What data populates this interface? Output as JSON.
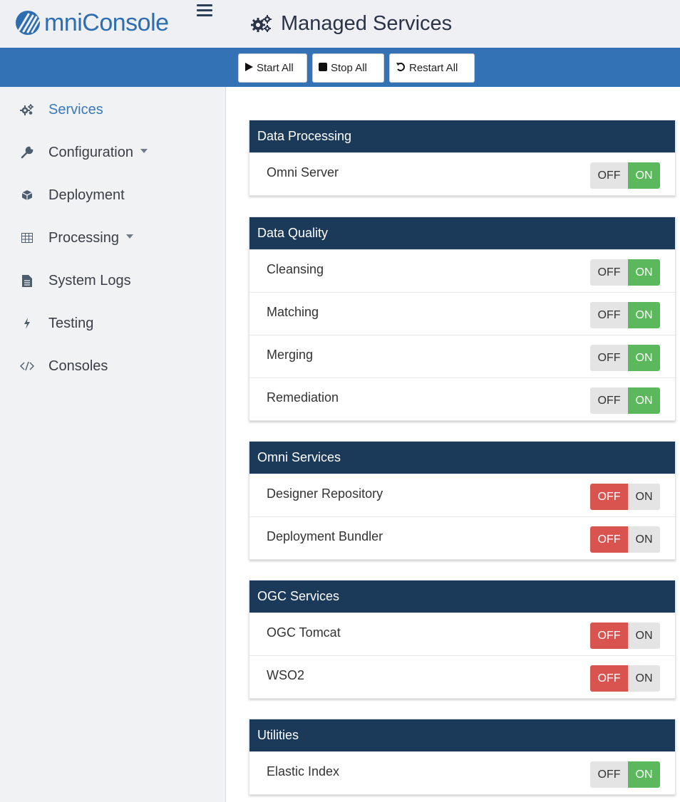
{
  "app": {
    "logo_text": "mniConsole",
    "page_title": "Managed Services"
  },
  "toolbar": {
    "start_all": "Start All",
    "stop_all": "Stop All",
    "restart_all": "Restart All"
  },
  "sidebar": {
    "items": [
      {
        "label": "Services",
        "icon": "cogs-icon",
        "active": true
      },
      {
        "label": "Configuration",
        "icon": "wrench-icon",
        "has_caret": true
      },
      {
        "label": "Deployment",
        "icon": "cube-icon"
      },
      {
        "label": "Processing",
        "icon": "table-icon",
        "has_caret": true
      },
      {
        "label": "System Logs",
        "icon": "file-icon"
      },
      {
        "label": "Testing",
        "icon": "bolt-icon"
      },
      {
        "label": "Consoles",
        "icon": "code-icon"
      }
    ]
  },
  "toggle_labels": {
    "off": "OFF",
    "on": "ON"
  },
  "groups": [
    {
      "title": "Data Processing",
      "services": [
        {
          "name": "Omni Server",
          "state": "on"
        }
      ]
    },
    {
      "title": "Data Quality",
      "services": [
        {
          "name": "Cleansing",
          "state": "on"
        },
        {
          "name": "Matching",
          "state": "on"
        },
        {
          "name": "Merging",
          "state": "on"
        },
        {
          "name": "Remediation",
          "state": "on"
        }
      ]
    },
    {
      "title": "Omni Services",
      "services": [
        {
          "name": "Designer Repository",
          "state": "off"
        },
        {
          "name": "Deployment Bundler",
          "state": "off"
        }
      ]
    },
    {
      "title": "OGC Services",
      "services": [
        {
          "name": "OGC Tomcat",
          "state": "off"
        },
        {
          "name": "WSO2",
          "state": "off"
        }
      ]
    },
    {
      "title": "Utilities",
      "services": [
        {
          "name": "Elastic Index",
          "state": "on"
        }
      ]
    }
  ],
  "colors": {
    "header_bg": "#eef0f3",
    "toolbar_bg": "#3372b5",
    "panel_head_bg": "#1b3a5a",
    "on_green": "#5cb85c",
    "off_red": "#d9534f",
    "accent_blue": "#2d6db0"
  }
}
